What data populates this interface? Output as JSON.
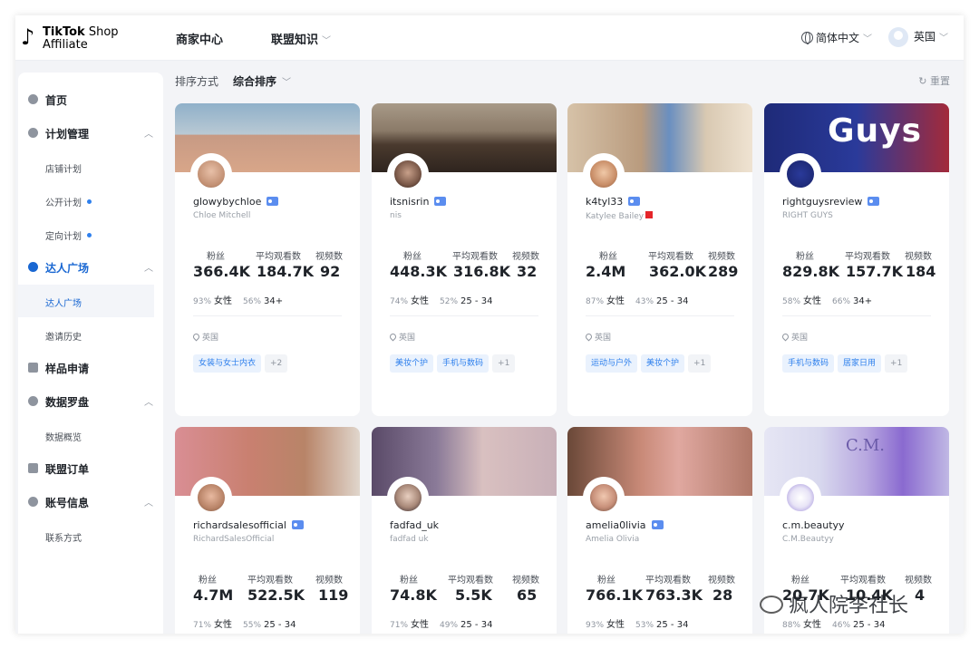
{
  "header": {
    "logo_line1_a": "TikTok",
    "logo_line1_b": "Shop",
    "logo_line2": "Affiliate",
    "nav": [
      {
        "label": "商家中心"
      },
      {
        "label": "联盟知识"
      }
    ],
    "language": "简体中文",
    "region": "英国"
  },
  "sidebar": {
    "items": [
      {
        "label": "首页"
      },
      {
        "label": "计划管理"
      },
      {
        "label": "店铺计划"
      },
      {
        "label": "公开计划"
      },
      {
        "label": "定向计划"
      },
      {
        "label": "达人广场"
      },
      {
        "label": "达人广场"
      },
      {
        "label": "邀请历史"
      },
      {
        "label": "样品申请"
      },
      {
        "label": "数据罗盘"
      },
      {
        "label": "数据概览"
      },
      {
        "label": "联盟订单"
      },
      {
        "label": "账号信息"
      },
      {
        "label": "联系方式"
      }
    ]
  },
  "toolbar": {
    "sort_label": "排序方式",
    "sort_value": "综合排序",
    "reset": "重置"
  },
  "stat_labels": {
    "followers": "粉丝",
    "avg_views": "平均观看数",
    "videos": "视频数"
  },
  "creators": [
    {
      "username": "glowybychloe",
      "display": "Chloe Mitchell",
      "followers": "366.4K",
      "avg_views": "184.7K",
      "videos": "92",
      "gender_pct": "93%",
      "gender": "女性",
      "age_pct": "56%",
      "age": "34+",
      "location": "英国",
      "tags": [
        "女装与女士内衣",
        "+2"
      ]
    },
    {
      "username": "itsnisrin",
      "display": "nis",
      "followers": "448.3K",
      "avg_views": "316.8K",
      "videos": "32",
      "gender_pct": "74%",
      "gender": "女性",
      "age_pct": "52%",
      "age": "25 - 34",
      "location": "英国",
      "tags": [
        "美妆个护",
        "手机与数码",
        "+1"
      ]
    },
    {
      "username": "k4tyl33",
      "display": "Katylee Bailey",
      "followers": "2.4M",
      "avg_views": "362.0K",
      "videos": "289",
      "gender_pct": "87%",
      "gender": "女性",
      "age_pct": "43%",
      "age": "25 - 34",
      "location": "英国",
      "tags": [
        "运动与户外",
        "美妆个护",
        "+1"
      ]
    },
    {
      "username": "rightguysreview",
      "display": "RIGHT GUYS",
      "followers": "829.8K",
      "avg_views": "157.7K",
      "videos": "184",
      "gender_pct": "58%",
      "gender": "女性",
      "age_pct": "66%",
      "age": "34+",
      "location": "英国",
      "tags": [
        "手机与数码",
        "居家日用",
        "+1"
      ]
    },
    {
      "username": "richardsalesofficial",
      "display": "RichardSalesOfficial",
      "followers": "4.7M",
      "avg_views": "522.5K",
      "videos": "119",
      "gender_pct": "71%",
      "gender": "女性",
      "age_pct": "55%",
      "age": "25 - 34"
    },
    {
      "username": "fadfad_uk",
      "display": "fadfad uk",
      "followers": "74.8K",
      "avg_views": "5.5K",
      "videos": "65",
      "gender_pct": "71%",
      "gender": "女性",
      "age_pct": "49%",
      "age": "25 - 34"
    },
    {
      "username": "amelia0livia",
      "display": "Amelia Olivia",
      "followers": "766.1K",
      "avg_views": "763.3K",
      "videos": "28",
      "gender_pct": "93%",
      "gender": "女性",
      "age_pct": "53%",
      "age": "25 - 34"
    },
    {
      "username": "c.m.beautyy",
      "display": "C.M.Beautyy",
      "followers": "20.7K",
      "avg_views": "10.4K",
      "videos": "4",
      "gender_pct": "88%",
      "gender": "女性",
      "age_pct": "46%",
      "age": "25 - 34"
    }
  ],
  "watermark": "疯人院李社长",
  "colors": {
    "accent": "#2f80ed",
    "active": "#1967d2",
    "bg": "#f3f4f7"
  }
}
